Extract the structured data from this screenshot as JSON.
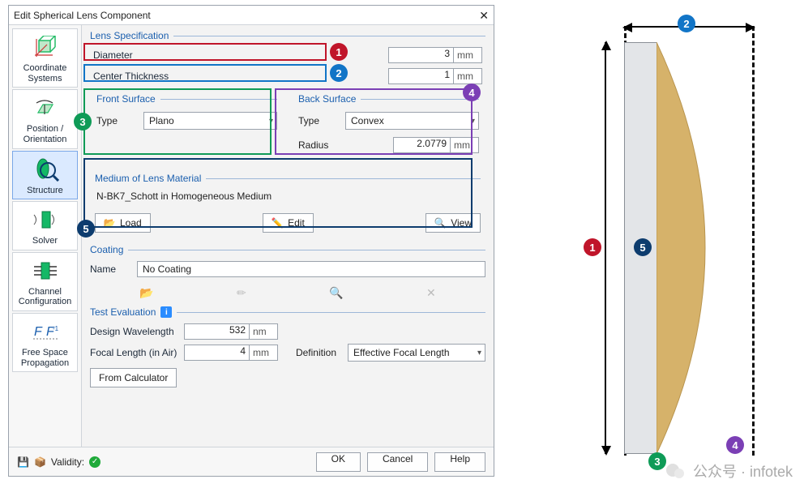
{
  "dialog": {
    "title": "Edit Spherical Lens Component",
    "close_label": "✕"
  },
  "sidebar": {
    "items": [
      {
        "label": "Coordinate\nSystems"
      },
      {
        "label": "Position /\nOrientation"
      },
      {
        "label": "Structure"
      },
      {
        "label": "Solver"
      },
      {
        "label": "Channel\nConfiguration"
      },
      {
        "label": "Free Space\nPropagation"
      }
    ]
  },
  "spec": {
    "header": "Lens Specification",
    "diameter_label": "Diameter",
    "diameter_value": "3",
    "diameter_unit": "mm",
    "thickness_label": "Center Thickness",
    "thickness_value": "1",
    "thickness_unit": "mm"
  },
  "front": {
    "header": "Front Surface",
    "type_label": "Type",
    "type_value": "Plano"
  },
  "back": {
    "header": "Back Surface",
    "type_label": "Type",
    "type_value": "Convex",
    "radius_label": "Radius",
    "radius_value": "2.0779",
    "radius_unit": "mm"
  },
  "material": {
    "header": "Medium of Lens Material",
    "value": "N-BK7_Schott in Homogeneous Medium",
    "load_label": "Load",
    "edit_label": "Edit",
    "view_label": "View"
  },
  "coating": {
    "header": "Coating",
    "name_label": "Name",
    "name_value": "No Coating"
  },
  "test": {
    "header": "Test Evaluation",
    "wavelength_label": "Design Wavelength",
    "wavelength_value": "532",
    "wavelength_unit": "nm",
    "focal_label": "Focal Length (in Air)",
    "focal_value": "4",
    "focal_unit": "mm",
    "definition_label": "Definition",
    "definition_value": "Effective Focal Length",
    "from_calc_label": "From Calculator"
  },
  "bottom": {
    "validity_label": "Validity:",
    "ok_label": "OK",
    "cancel_label": "Cancel",
    "help_label": "Help"
  },
  "badges": {
    "b1": "1",
    "b2": "2",
    "b3": "3",
    "b4": "4",
    "b5": "5"
  },
  "watermark": {
    "text": "公众号 · infotek"
  }
}
